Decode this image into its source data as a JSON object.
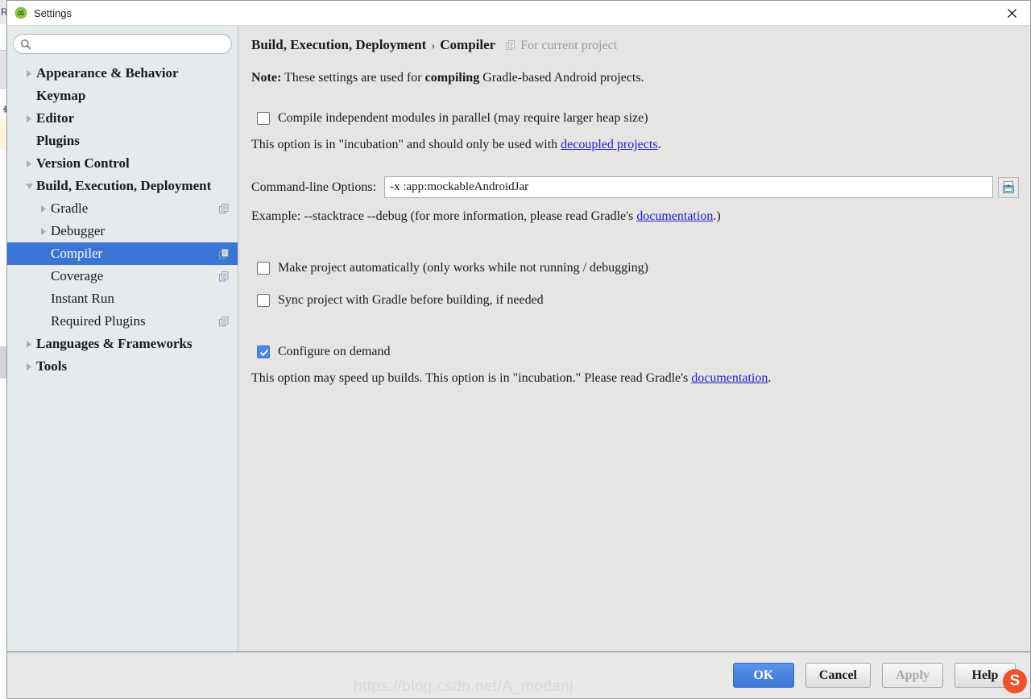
{
  "background": {
    "tool_window_label": "R",
    "icons": [
      "gear-icon"
    ]
  },
  "window": {
    "title": "Settings",
    "app_icon": "android-studio-icon",
    "close_icon": "close-icon"
  },
  "search": {
    "value": "",
    "placeholder": "",
    "icon": "search-icon"
  },
  "sidebar": {
    "items": [
      {
        "label": "Appearance & Behavior",
        "level": 0,
        "arrow": "collapsed",
        "copy": false,
        "selected": false
      },
      {
        "label": "Keymap",
        "level": 0,
        "arrow": "none",
        "copy": false,
        "selected": false
      },
      {
        "label": "Editor",
        "level": 0,
        "arrow": "collapsed",
        "copy": false,
        "selected": false
      },
      {
        "label": "Plugins",
        "level": 0,
        "arrow": "none",
        "copy": false,
        "selected": false
      },
      {
        "label": "Version Control",
        "level": 0,
        "arrow": "collapsed",
        "copy": false,
        "selected": false
      },
      {
        "label": "Build, Execution, Deployment",
        "level": 0,
        "arrow": "expanded",
        "copy": false,
        "selected": false
      },
      {
        "label": "Gradle",
        "level": 1,
        "arrow": "collapsed",
        "copy": true,
        "selected": false
      },
      {
        "label": "Debugger",
        "level": 1,
        "arrow": "collapsed",
        "copy": false,
        "selected": false
      },
      {
        "label": "Compiler",
        "level": 1,
        "arrow": "none",
        "copy": true,
        "selected": true
      },
      {
        "label": "Coverage",
        "level": 1,
        "arrow": "none",
        "copy": true,
        "selected": false
      },
      {
        "label": "Instant Run",
        "level": 1,
        "arrow": "none",
        "copy": false,
        "selected": false
      },
      {
        "label": "Required Plugins",
        "level": 1,
        "arrow": "none",
        "copy": true,
        "selected": false
      },
      {
        "label": "Languages & Frameworks",
        "level": 0,
        "arrow": "collapsed",
        "copy": false,
        "selected": false
      },
      {
        "label": "Tools",
        "level": 0,
        "arrow": "collapsed",
        "copy": false,
        "selected": false
      }
    ]
  },
  "main": {
    "breadcrumb": {
      "parent": "Build, Execution, Deployment",
      "separator": "›",
      "current": "Compiler",
      "scope_icon": "copy-icon",
      "scope_label": "For current project"
    },
    "note": {
      "prefix": "Note:",
      "text_1": " These settings are used for ",
      "emphasis": "compiling",
      "text_2": " Gradle-based Android projects."
    },
    "parallel": {
      "checked": false,
      "label": "Compile independent modules in parallel (may require larger heap size)",
      "desc_1": "This option is in \"incubation\" and should only be used with ",
      "desc_link": "decoupled projects",
      "desc_2": "."
    },
    "command_line": {
      "label": "Command-line Options:",
      "value": "-x :app:mockableAndroidJar",
      "placeholder": "",
      "expand_icon": "expand-editor-icon",
      "example_1": "Example: --stacktrace --debug (for more information, please read Gradle's ",
      "example_link": "documentation",
      "example_2": ".)"
    },
    "make_automatically": {
      "checked": false,
      "label": "Make project automatically (only works while not running / debugging)"
    },
    "sync_before_build": {
      "checked": false,
      "label": "Sync project with Gradle before building, if needed"
    },
    "configure_on_demand": {
      "checked": true,
      "label": "Configure on demand",
      "desc_1": "This option may speed up builds. This option is in \"incubation.\" Please read Gradle's ",
      "desc_link": "documentation",
      "desc_2": "."
    }
  },
  "footer": {
    "ok": "OK",
    "cancel": "Cancel",
    "apply": "Apply",
    "help": "Help",
    "watermark": "https://blog.csdn.net/A_modanj",
    "logo_glyph": "S"
  },
  "colors": {
    "accent": "#3a74d6",
    "link": "#2020d0",
    "sidebar_bg": "#e5eaed",
    "panel_bg": "#e6e5e3",
    "checkbox_checked": "#4a87e8"
  }
}
